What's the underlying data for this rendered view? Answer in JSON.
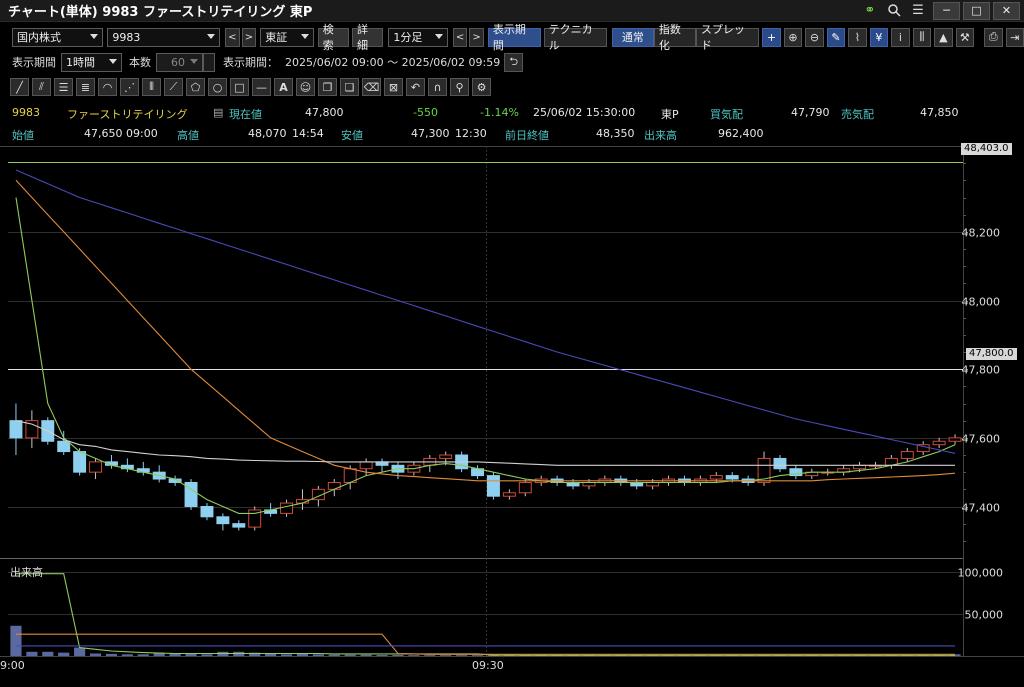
{
  "window": {
    "title": "チャート(単体) 9983 ファーストリテイリング 東P",
    "icons": [
      "link-icon",
      "search-icon",
      "menu-icon"
    ],
    "buttons": {
      "minimize": "─",
      "maximize": "□",
      "close": "✕"
    }
  },
  "toolbar1": {
    "market": "国内株式",
    "code": "9983",
    "exchange": "東証",
    "search": "検索",
    "detail": "詳細",
    "interval": "1分足",
    "display_period": "表示期間",
    "technical": "テクニカル",
    "normal": "通常",
    "indexed": "指数化",
    "spread": "スプレッド"
  },
  "toolbar2": {
    "period_label": "表示期間",
    "period_value": "1時間",
    "count_label": "本数",
    "count_value": "60",
    "range_label": "表示期間：",
    "range_value": "2025/06/02 09:00 ～ 2025/06/02 09:59"
  },
  "quote": {
    "code": "9983",
    "name": "ファーストリテイリング",
    "current_label": "現在値",
    "current": "47,800",
    "change": "-550",
    "change_pct": "-1.14%",
    "datetime": "25/06/02 15:30:00",
    "market": "東P",
    "bid_label": "買気配",
    "bid": "47,790",
    "ask_label": "売気配",
    "ask": "47,850",
    "open_label": "始値",
    "open": "47,650",
    "open_time": "09:00",
    "high_label": "高値",
    "high": "48,070",
    "high_time": "14:54",
    "low_label": "安値",
    "low": "47,300",
    "low_time": "12:30",
    "prev_label": "前日終値",
    "prev": "48,350",
    "volume_label": "出来高",
    "volume": "962,400"
  },
  "chart_labels": {
    "volume_pane": "出来高",
    "x_tick_0": "9:00",
    "x_tick_1": "09:30",
    "top_tag": "48,403.0",
    "current_tag": "47,800.0"
  },
  "colors": {
    "up_candle": "#c8c8c8",
    "up_candle_border": "#d04a3a",
    "down_candle": "#8fd0f0",
    "ma_short": "#8ecb5a",
    "ma_mid": "#e08a3a",
    "ma_long": "#4a4ab8",
    "vwap": "#d0d0d0"
  },
  "chart_data": {
    "type": "candlestick",
    "title": "",
    "x": [
      "09:00",
      "09:01",
      "09:02",
      "09:03",
      "09:04",
      "09:05",
      "09:06",
      "09:07",
      "09:08",
      "09:09",
      "09:10",
      "09:11",
      "09:12",
      "09:13",
      "09:14",
      "09:15",
      "09:16",
      "09:17",
      "09:18",
      "09:19",
      "09:20",
      "09:21",
      "09:22",
      "09:23",
      "09:24",
      "09:25",
      "09:26",
      "09:27",
      "09:28",
      "09:29",
      "09:30",
      "09:31",
      "09:32",
      "09:33",
      "09:34",
      "09:35",
      "09:36",
      "09:37",
      "09:38",
      "09:39",
      "09:40",
      "09:41",
      "09:42",
      "09:43",
      "09:44",
      "09:45",
      "09:46",
      "09:47",
      "09:48",
      "09:49",
      "09:50",
      "09:51",
      "09:52",
      "09:53",
      "09:54",
      "09:55",
      "09:56",
      "09:57",
      "09:58",
      "09:59"
    ],
    "ohlc": [
      [
        47650,
        47700,
        47550,
        47600
      ],
      [
        47600,
        47680,
        47570,
        47650
      ],
      [
        47650,
        47660,
        47580,
        47590
      ],
      [
        47590,
        47620,
        47550,
        47560
      ],
      [
        47560,
        47570,
        47490,
        47500
      ],
      [
        47500,
        47540,
        47480,
        47530
      ],
      [
        47530,
        47550,
        47510,
        47520
      ],
      [
        47520,
        47540,
        47500,
        47510
      ],
      [
        47510,
        47530,
        47490,
        47500
      ],
      [
        47500,
        47520,
        47470,
        47480
      ],
      [
        47480,
        47490,
        47460,
        47470
      ],
      [
        47470,
        47480,
        47390,
        47400
      ],
      [
        47400,
        47410,
        47360,
        47370
      ],
      [
        47370,
        47380,
        47330,
        47350
      ],
      [
        47350,
        47360,
        47330,
        47340
      ],
      [
        47340,
        47400,
        47330,
        47390
      ],
      [
        47390,
        47410,
        47370,
        47380
      ],
      [
        47380,
        47420,
        47370,
        47410
      ],
      [
        47410,
        47450,
        47390,
        47420
      ],
      [
        47420,
        47460,
        47400,
        47450
      ],
      [
        47450,
        47480,
        47430,
        47470
      ],
      [
        47470,
        47520,
        47450,
        47510
      ],
      [
        47510,
        47540,
        47490,
        47530
      ],
      [
        47530,
        47540,
        47500,
        47520
      ],
      [
        47520,
        47530,
        47480,
        47500
      ],
      [
        47500,
        47530,
        47490,
        47520
      ],
      [
        47520,
        47550,
        47500,
        47540
      ],
      [
        47540,
        47560,
        47520,
        47550
      ],
      [
        47550,
        47560,
        47500,
        47510
      ],
      [
        47510,
        47520,
        47480,
        47490
      ],
      [
        47490,
        47500,
        47420,
        47430
      ],
      [
        47430,
        47450,
        47420,
        47440
      ],
      [
        47440,
        47480,
        47430,
        47470
      ],
      [
        47470,
        47490,
        47460,
        47480
      ],
      [
        47480,
        47490,
        47460,
        47470
      ],
      [
        47470,
        47480,
        47450,
        47460
      ],
      [
        47460,
        47480,
        47450,
        47470
      ],
      [
        47470,
        47490,
        47460,
        47480
      ],
      [
        47480,
        47490,
        47460,
        47470
      ],
      [
        47470,
        47480,
        47450,
        47460
      ],
      [
        47460,
        47480,
        47450,
        47470
      ],
      [
        47470,
        47490,
        47460,
        47480
      ],
      [
        47480,
        47490,
        47460,
        47470
      ],
      [
        47470,
        47490,
        47460,
        47480
      ],
      [
        47480,
        47500,
        47470,
        47490
      ],
      [
        47490,
        47500,
        47470,
        47480
      ],
      [
        47480,
        47490,
        47460,
        47470
      ],
      [
        47470,
        47560,
        47460,
        47540
      ],
      [
        47540,
        47550,
        47500,
        47510
      ],
      [
        47510,
        47520,
        47480,
        47490
      ],
      [
        47490,
        47510,
        47480,
        47500
      ],
      [
        47500,
        47510,
        47490,
        47500
      ],
      [
        47500,
        47520,
        47490,
        47510
      ],
      [
        47510,
        47530,
        47500,
        47520
      ],
      [
        47520,
        47530,
        47510,
        47520
      ],
      [
        47520,
        47550,
        47510,
        47540
      ],
      [
        47540,
        47570,
        47530,
        47560
      ],
      [
        47560,
        47590,
        47550,
        47580
      ],
      [
        47580,
        47600,
        47570,
        47590
      ],
      [
        47590,
        47610,
        47580,
        47600
      ]
    ],
    "ylim": [
      47250,
      48450
    ],
    "y_ticks": [
      47400,
      47600,
      47800,
      48000,
      48200
    ],
    "volume_ylim": [
      0,
      100000
    ],
    "volume_ticks": [
      50000,
      100000
    ],
    "volume": [
      36000,
      5000,
      5000,
      4000,
      10000,
      3000,
      2500,
      2000,
      2000,
      4000,
      3000,
      2500,
      2000,
      5000,
      5000,
      4000,
      3000,
      2000,
      2500,
      2000,
      1500,
      1500,
      1500,
      1200,
      1200,
      1000,
      1000,
      1000,
      1000,
      1000,
      800,
      800,
      800,
      800,
      800,
      800,
      800,
      800,
      800,
      800,
      800,
      800,
      800,
      800,
      800,
      800,
      800,
      800,
      800,
      800,
      800,
      800,
      800,
      800,
      800,
      800,
      800,
      800,
      1000,
      2000
    ],
    "grid": true,
    "lines": [
      {
        "name": "",
        "color": "#8ecb5a",
        "values": [
          48300,
          48000,
          47700,
          47600,
          47560,
          47540,
          47520,
          47510,
          47500,
          47490,
          47480,
          47450,
          47420,
          47400,
          47380,
          47380,
          47390,
          47400,
          47410,
          47430,
          47450,
          47470,
          47490,
          47500,
          47510,
          47510,
          47520,
          47525,
          47520,
          47510,
          47500,
          47490,
          47480,
          47475,
          47470,
          47470,
          47470,
          47470,
          47470,
          47470,
          47470,
          47470,
          47470,
          47470,
          47470,
          47475,
          47475,
          47480,
          47490,
          47495,
          47500,
          47500,
          47500,
          47505,
          47510,
          47520,
          47530,
          47545,
          47560,
          47580
        ]
      },
      {
        "name": "",
        "color": "#e08a3a",
        "values": [
          48350,
          48300,
          48250,
          48200,
          48150,
          48100,
          48050,
          48000,
          47950,
          47900,
          47850,
          47800,
          47760,
          47720,
          47680,
          47640,
          47600,
          47580,
          47560,
          47540,
          47520,
          47510,
          47500,
          47495,
          47490,
          47487,
          47484,
          47481,
          47478,
          47475,
          47475,
          47475,
          47475,
          47475,
          47475,
          47475,
          47475,
          47475,
          47475,
          47475,
          47475,
          47475,
          47475,
          47475,
          47475,
          47475,
          47475,
          47475,
          47475,
          47475,
          47475,
          47478,
          47480,
          47482,
          47484,
          47486,
          47488,
          47490,
          47493,
          47497
        ]
      },
      {
        "name": "",
        "color": "#4a4ab8",
        "values": [
          48380,
          48360,
          48340,
          48320,
          48300,
          48285,
          48270,
          48255,
          48240,
          48225,
          48210,
          48195,
          48180,
          48165,
          48150,
          48135,
          48120,
          48105,
          48090,
          48075,
          48060,
          48045,
          48030,
          48015,
          48000,
          47985,
          47970,
          47955,
          47940,
          47925,
          47910,
          47895,
          47880,
          47865,
          47850,
          47837,
          47824,
          47811,
          47798,
          47785,
          47772,
          47759,
          47746,
          47733,
          47720,
          47707,
          47694,
          47681,
          47668,
          47655,
          47645,
          47635,
          47625,
          47615,
          47605,
          47595,
          47585,
          47575,
          47565,
          47555
        ]
      },
      {
        "name": "",
        "color": "#d0d0d0",
        "values": [
          47650,
          47640,
          47620,
          47595,
          47580,
          47575,
          47565,
          47560,
          47555,
          47550,
          47548,
          47545,
          47540,
          47538,
          47535,
          47534,
          47533,
          47532,
          47532,
          47531,
          47530,
          47530,
          47530,
          47530,
          47530,
          47530,
          47530,
          47530,
          47530,
          47530,
          47528,
          47526,
          47524,
          47522,
          47520,
          47520,
          47520,
          47520,
          47520,
          47520,
          47520,
          47520,
          47520,
          47520,
          47520,
          47520,
          47520,
          47520,
          47520,
          47520,
          47520,
          47520,
          47520,
          47520,
          47520,
          47520,
          47520,
          47520,
          47520,
          47520
        ]
      }
    ],
    "volume_lines": [
      {
        "name": "",
        "color": "#8ecb5a",
        "values": [
          98000,
          98000,
          98000,
          98000,
          10000,
          8000,
          6000,
          5000,
          4000,
          3500,
          3000,
          3000,
          3000,
          3000,
          3000,
          3000,
          3000,
          3000,
          3000,
          3000,
          2500,
          2500,
          2500,
          2500,
          2500,
          2500,
          2500,
          2500,
          2500,
          2500,
          1000,
          900,
          800,
          800,
          800,
          800,
          800,
          800,
          800,
          800,
          800,
          800,
          800,
          800,
          800,
          800,
          800,
          800,
          800,
          800,
          800,
          800,
          800,
          800,
          800,
          800,
          800,
          800,
          800,
          800
        ]
      },
      {
        "name": "",
        "color": "#e08a3a",
        "values": [
          26000,
          26000,
          26000,
          26000,
          26000,
          26000,
          26000,
          26000,
          26000,
          26000,
          26000,
          26000,
          26000,
          26000,
          26000,
          26000,
          26000,
          26000,
          26000,
          26000,
          26000,
          26000,
          26000,
          26000,
          3000,
          2500,
          2000,
          2000,
          2000,
          2000,
          2000,
          2000,
          2000,
          2000,
          2000,
          2000,
          2000,
          2000,
          2000,
          2000,
          2000,
          2000,
          2000,
          2000,
          2000,
          2000,
          2000,
          2000,
          2000,
          2000,
          2000,
          2000,
          2000,
          2000,
          2000,
          2000,
          2000,
          2000,
          2000,
          2000
        ]
      },
      {
        "name": "",
        "color": "#4a4ab8",
        "values": [
          12000,
          12000,
          12000,
          12000,
          12000,
          12000,
          12000,
          12000,
          12000,
          12000,
          12000,
          12000,
          12000,
          12000,
          12000,
          12000,
          12000,
          12000,
          12000,
          12000,
          12000,
          12000,
          12000,
          12000,
          12000,
          12000,
          12000,
          12000,
          12000,
          12000,
          12000,
          12000,
          12000,
          12000,
          12000,
          12000,
          12000,
          12000,
          12000,
          12000,
          12000,
          12000,
          12000,
          12000,
          12000,
          12000,
          12000,
          12000,
          12000,
          12000,
          12000,
          12000,
          12000,
          12000,
          12000,
          12000,
          12000,
          12000,
          12000,
          12000
        ]
      }
    ],
    "hlines": [
      {
        "value": 48403,
        "color": "#8ecb5a"
      },
      {
        "value": 47800,
        "color": "#e0e0e0"
      }
    ],
    "xlabel": "",
    "ylabel": ""
  }
}
